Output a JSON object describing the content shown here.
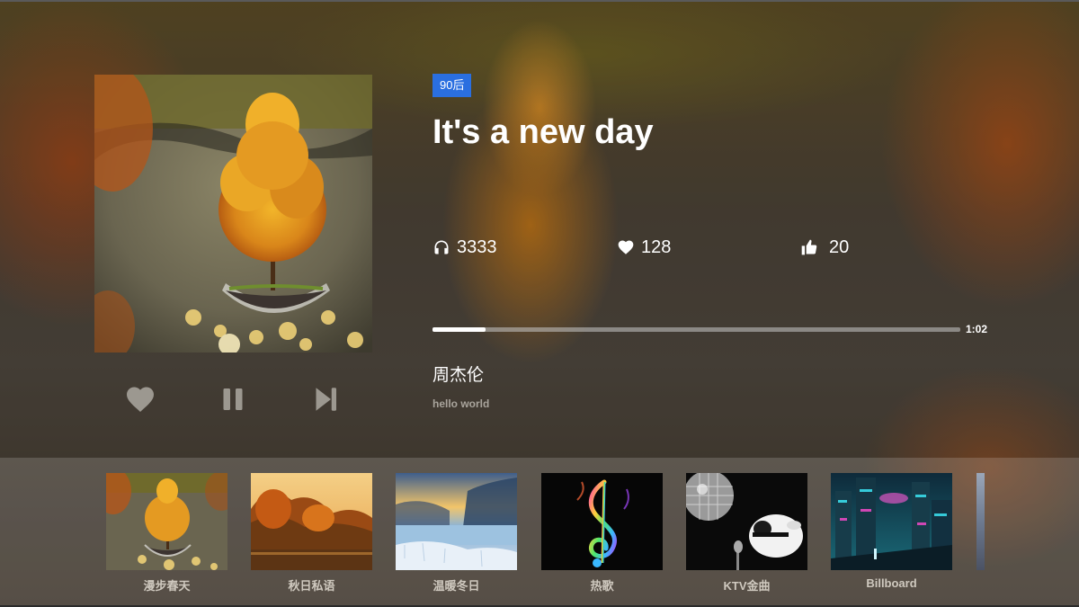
{
  "colors": {
    "tag_bg": "#2a6fe0",
    "progress_fill": "#ffffff",
    "progress_track": "#c8c8c8",
    "muted_text": "#a9a49c"
  },
  "song": {
    "tag": "90后",
    "title": "It's a new day",
    "artist": "周杰伦",
    "description": "hello world"
  },
  "stats": {
    "plays": "3333",
    "likes": "128",
    "thumbs_up": "20"
  },
  "player": {
    "progress": 0.1,
    "time": "1:02"
  },
  "icons": {
    "plays": "headphones-icon",
    "likes": "heart-icon",
    "thumbs": "thumbs-up-icon",
    "control_like": "heart-icon",
    "control_pause": "pause-icon",
    "control_next": "skip-next-icon"
  },
  "playlists": [
    {
      "label": "漫步春天",
      "image": "autumn-tree-terrarium"
    },
    {
      "label": "秋日私语",
      "image": "autumn-lake-forest"
    },
    {
      "label": "温暖冬日",
      "image": "frosty-winter-lake"
    },
    {
      "label": "热歌",
      "image": "colorful-treble-clef"
    },
    {
      "label": "KTV金曲",
      "image": "disco-ball-cow"
    },
    {
      "label": "Billboard",
      "image": "cyberpunk-city"
    }
  ]
}
